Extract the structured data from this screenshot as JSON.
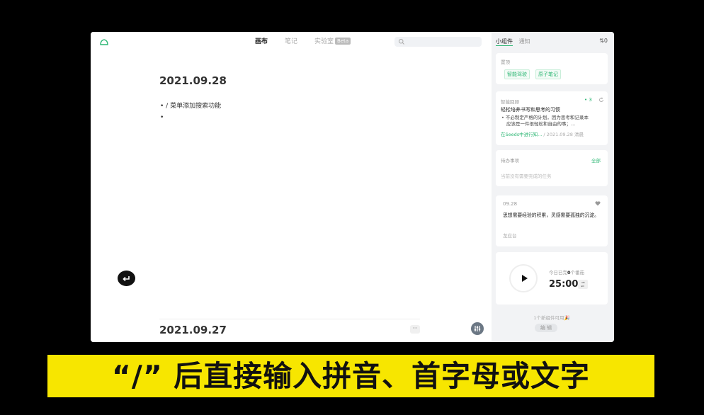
{
  "editor": {
    "tabs": [
      {
        "label": "画布"
      },
      {
        "label": "笔记"
      },
      {
        "label": "实验室"
      }
    ],
    "beta_badge": "Beta",
    "search_placeholder": "",
    "date_current": "2021.09.28",
    "bullets": [
      "• / 菜单添加搜索功能",
      "•"
    ],
    "date_previous": "2021.09.27",
    "more_label": "···"
  },
  "sidebar": {
    "tabs": [
      {
        "label": "小组件"
      },
      {
        "label": "通知"
      }
    ],
    "sort_label": "⇅0",
    "pin": {
      "title": "置顶",
      "tags": [
        "智能驾驶",
        "原子笔记"
      ]
    },
    "review": {
      "title": "智能回顾",
      "count": "• 3",
      "heading": "轻松培养书写和思考的习惯",
      "line1": "• 不必制定严格的计划，因为思考和记录本",
      "line2": "应该是一件很轻松和自由的事；...",
      "source": "在Seeds中进行知...",
      "meta": "/ 2021.09.28 清晨"
    },
    "todo": {
      "title": "待办事项",
      "all_label": "全部",
      "empty": "当前没有需要完成的任务"
    },
    "quote": {
      "date": "09.28",
      "text": "思想需要经验的积累，灵感需要孤独的沉淀。",
      "author": "龙应台"
    },
    "timer": {
      "summary_prefix": "今日已完",
      "summary_count": "0",
      "summary_suffix": "个番茄",
      "time": "25:00"
    },
    "footer": "1个新组件可用🎉",
    "edit_label": "编 辑"
  },
  "caption": "“/” 后直接输入拼音、首字母或文字"
}
